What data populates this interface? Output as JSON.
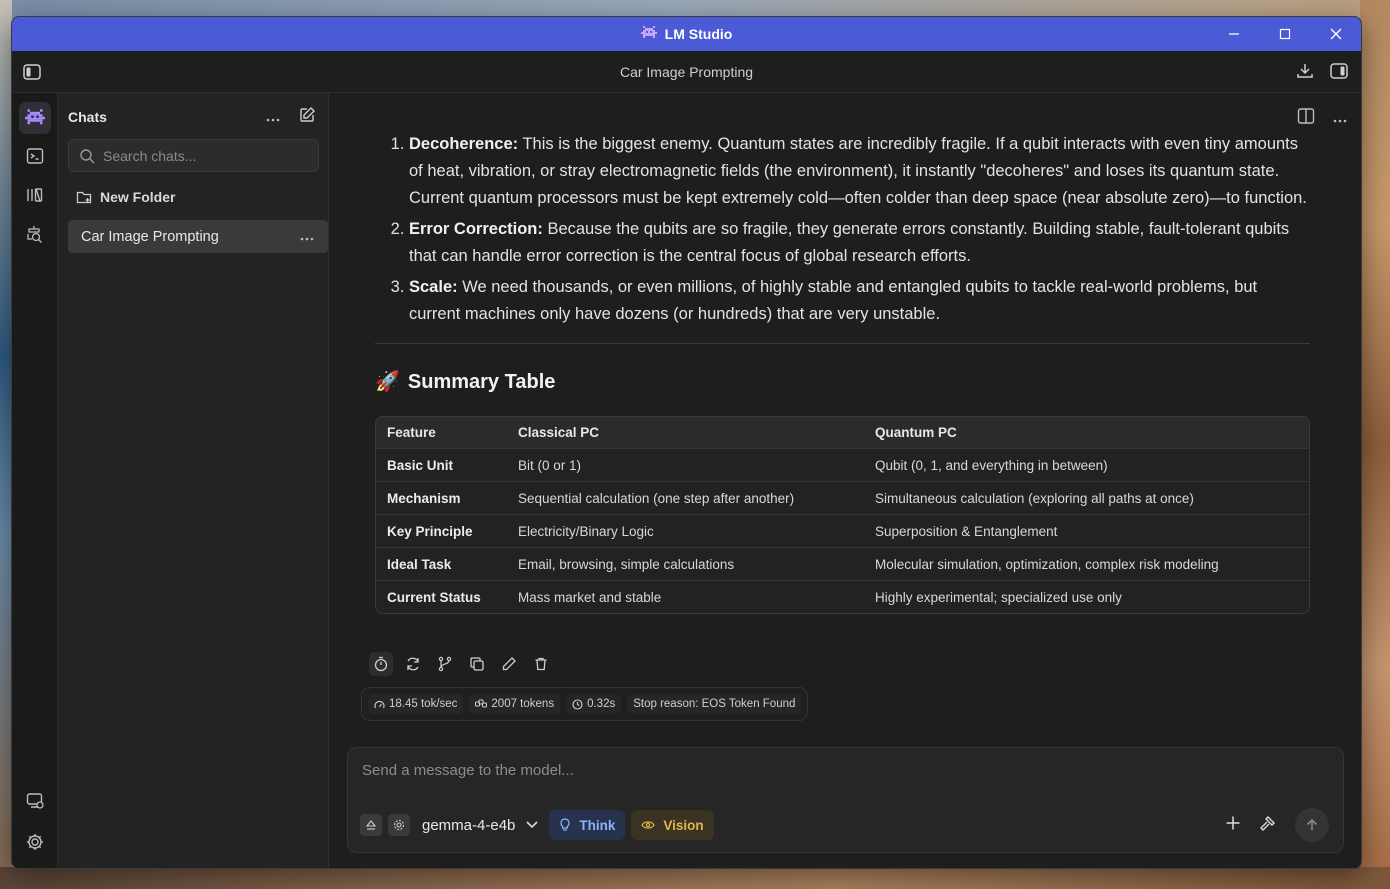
{
  "window": {
    "title": "LM Studio"
  },
  "toolbar": {
    "chat_title": "Car Image Prompting"
  },
  "sidebar": {
    "heading": "Chats",
    "search_placeholder": "Search chats...",
    "new_folder": "New Folder",
    "chats": [
      {
        "label": "Car Image Prompting",
        "selected": true
      }
    ]
  },
  "message": {
    "items": [
      {
        "num": "1.",
        "term": "Decoherence:",
        "text": "This is the biggest enemy. Quantum states are incredibly fragile. If a qubit interacts with even tiny amounts of heat, vibration, or stray electromagnetic fields (the environment), it instantly \"decoheres\" and loses its quantum state. Current quantum processors must be kept extremely cold—often colder than deep space (near absolute zero)—to function."
      },
      {
        "num": "2.",
        "term": "Error Correction:",
        "text": "Because the qubits are so fragile, they generate errors constantly. Building stable, fault-tolerant qubits that can handle error correction is the central focus of global research efforts."
      },
      {
        "num": "3.",
        "term": "Scale:",
        "text": "We need thousands, or even millions, of highly stable and entangled qubits to tackle real-world problems, but current machines only have dozens (or hundreds) that are very unstable."
      }
    ],
    "summary_emoji": "🚀",
    "summary_title": "Summary Table",
    "table": {
      "headers": [
        "Feature",
        "Classical PC",
        "Quantum PC"
      ],
      "rows": [
        [
          "Basic Unit",
          "Bit (0 or 1)",
          "Qubit (0, 1, and everything in between)"
        ],
        [
          "Mechanism",
          "Sequential calculation (one step after another)",
          "Simultaneous calculation (exploring all paths at once)"
        ],
        [
          "Key Principle",
          "Electricity/Binary Logic",
          "Superposition & Entanglement"
        ],
        [
          "Ideal Task",
          "Email, browsing, simple calculations",
          "Molecular simulation, optimization, complex risk modeling"
        ],
        [
          "Current Status",
          "Mass market and stable",
          "Highly experimental; specialized use only"
        ]
      ]
    }
  },
  "stats": {
    "speed": "18.45 tok/sec",
    "tokens": "2007 tokens",
    "time": "0.32s",
    "stop_reason": "Stop reason: EOS Token Found"
  },
  "composer": {
    "placeholder": "Send a message to the model...",
    "model": "gemma-4-e4b",
    "think_label": "Think",
    "vision_label": "Vision"
  },
  "colors": {
    "titlebar": "#4b5bd6",
    "accent_think": "#8fb2ff",
    "accent_vision": "#e0b64a"
  }
}
